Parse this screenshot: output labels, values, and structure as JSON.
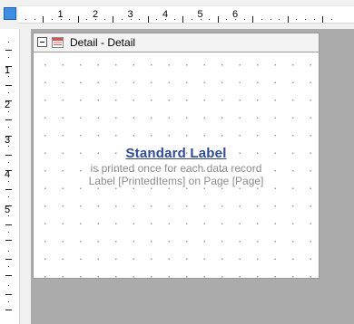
{
  "ruler": {
    "horizontal_numbers": [
      "1",
      "2",
      "3",
      "4",
      "5",
      "6"
    ],
    "vertical_numbers": [
      "1",
      "2",
      "3",
      "4",
      "5"
    ]
  },
  "band": {
    "title": "Detail - Detail"
  },
  "label": {
    "title": "Standard Label",
    "line1": "is printed once for each data record",
    "line2": "Label [PrintedItems] on Page [Page]"
  },
  "colors": {
    "background": "#ababab",
    "ruler_corner": "#3d8fe6",
    "label_title": "#2f4a9c",
    "label_text": "#8c8c8c"
  }
}
